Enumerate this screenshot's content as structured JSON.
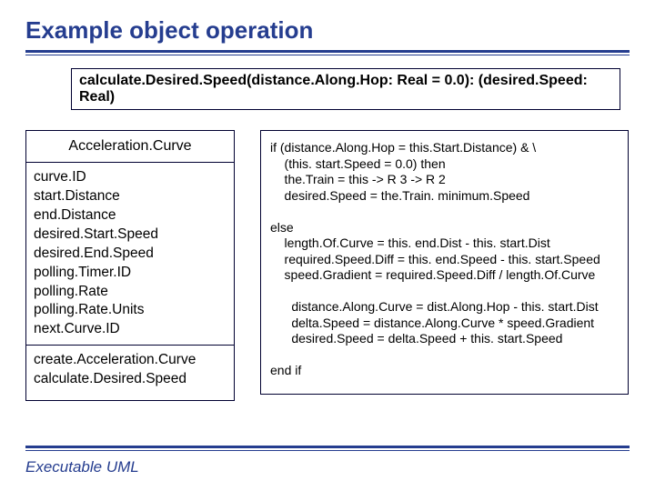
{
  "slide": {
    "title": "Example object operation",
    "signature": "calculate.Desired.Speed(distance.Along.Hop: Real = 0.0): (desired.Speed: Real)",
    "uml": {
      "name": "Acceleration.Curve",
      "attributes": [
        "curve.ID",
        "start.Distance",
        "end.Distance",
        "desired.Start.Speed",
        "desired.End.Speed",
        "polling.Timer.ID",
        "polling.Rate",
        "polling.Rate.Units",
        "next.Curve.ID"
      ],
      "operations": [
        "create.Acceleration.Curve",
        "calculate.Desired.Speed"
      ]
    },
    "code": "if (distance.Along.Hop = this.Start.Distance) & \\\n    (this. start.Speed = 0.0) then\n    the.Train = this -> R 3 -> R 2\n    desired.Speed = the.Train. minimum.Speed\n\nelse\n    length.Of.Curve = this. end.Dist - this. start.Dist\n    required.Speed.Diff = this. end.Speed - this. start.Speed\n    speed.Gradient = required.Speed.Diff / length.Of.Curve\n\n      distance.Along.Curve = dist.Along.Hop - this. start.Dist\n      delta.Speed = distance.Along.Curve * speed.Gradient\n      desired.Speed = delta.Speed + this. start.Speed\n\nend if",
    "footer": "Executable UML"
  }
}
